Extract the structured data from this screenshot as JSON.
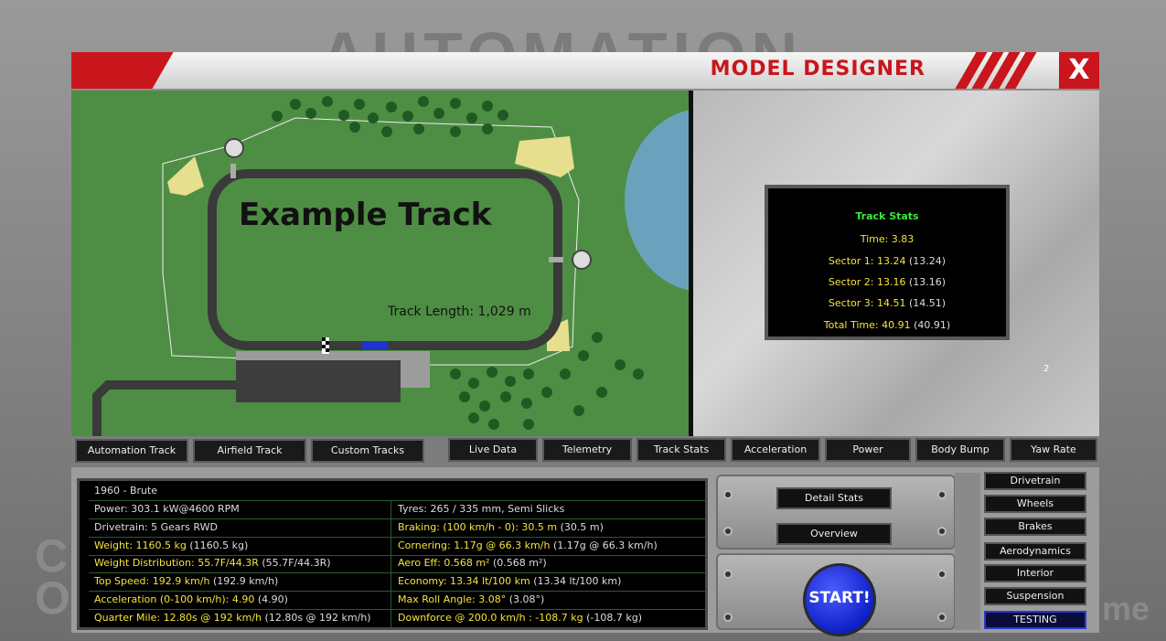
{
  "background": {
    "title": "AUTOMATION",
    "left_text": "C\nO",
    "right_text": "me"
  },
  "window": {
    "title": "MODEL DESIGNER",
    "close": "X"
  },
  "track": {
    "title": "Example Track",
    "length": "Track Length: 1,029 m"
  },
  "track_stats": {
    "heading": "Track Stats",
    "time": "Time: 3.83",
    "sector1": "Sector 1: 13.24",
    "sector1_best": "(13.24)",
    "sector2": "Sector 2: 13.16",
    "sector2_best": "(13.16)",
    "sector3": "Sector 3: 14.51",
    "sector3_best": "(14.51)",
    "total": "Total Time: 40.91",
    "total_best": "(40.91)"
  },
  "page_number": "2",
  "track_tabs": [
    "Automation Track",
    "Airfield Track",
    "Custom Tracks"
  ],
  "view_tabs": [
    "Live Data",
    "Telemetry",
    "Track Stats",
    "Acceleration",
    "Power",
    "Body Bump",
    "Yaw Rate"
  ],
  "car": {
    "name": "1960 - Brute",
    "rows": [
      {
        "l": "Power: 303.1 kW@4600 RPM",
        "lp": "",
        "r": "Tyres: 265 / 335 mm, Semi Slicks",
        "rp": ""
      },
      {
        "l": "Drivetrain: 5 Gears RWD",
        "lp": "",
        "r": "Braking: (100 km/h - 0): 30.5 m",
        "rp": "(30.5 m)"
      },
      {
        "l": "Weight: 1160.5 kg",
        "lp": "(1160.5 kg)",
        "r": "Cornering: 1.17g @ 66.3 km/h",
        "rp": "(1.17g @ 66.3 km/h)"
      },
      {
        "l": "Weight Distribution: 55.7F/44.3R",
        "lp": "(55.7F/44.3R)",
        "r": "Aero Eff: 0.568 m²",
        "rp": "(0.568 m²)"
      },
      {
        "l": "Top Speed: 192.9 km/h",
        "lp": "(192.9 km/h)",
        "r": "Economy: 13.34 lt/100 km",
        "rp": "(13.34 lt/100 km)"
      },
      {
        "l": "Acceleration (0-100 km/h): 4.90",
        "lp": "(4.90)",
        "r": "Max Roll Angle: 3.08°",
        "rp": "(3.08°)"
      },
      {
        "l": "Quarter Mile: 12.80s @ 192 km/h",
        "lp": "(12.80s @ 192 km/h)",
        "r": "Downforce @ 200.0 km/h : -108.7 kg",
        "rp": "(-108.7 kg)"
      }
    ]
  },
  "buttons": {
    "detail": "Detail Stats",
    "overview": "Overview",
    "start": "START!"
  },
  "side_menu": [
    "Drivetrain",
    "Wheels",
    "Brakes",
    "Aerodynamics",
    "Interior",
    "Suspension",
    "TESTING"
  ],
  "colors": {
    "accent_red": "#c8161c",
    "grass": "#4e8e44",
    "track": "#3a3a3a",
    "stat_yellow": "#f4e43a",
    "stat_green": "#3ce83c",
    "start_blue": "#1020c8"
  }
}
